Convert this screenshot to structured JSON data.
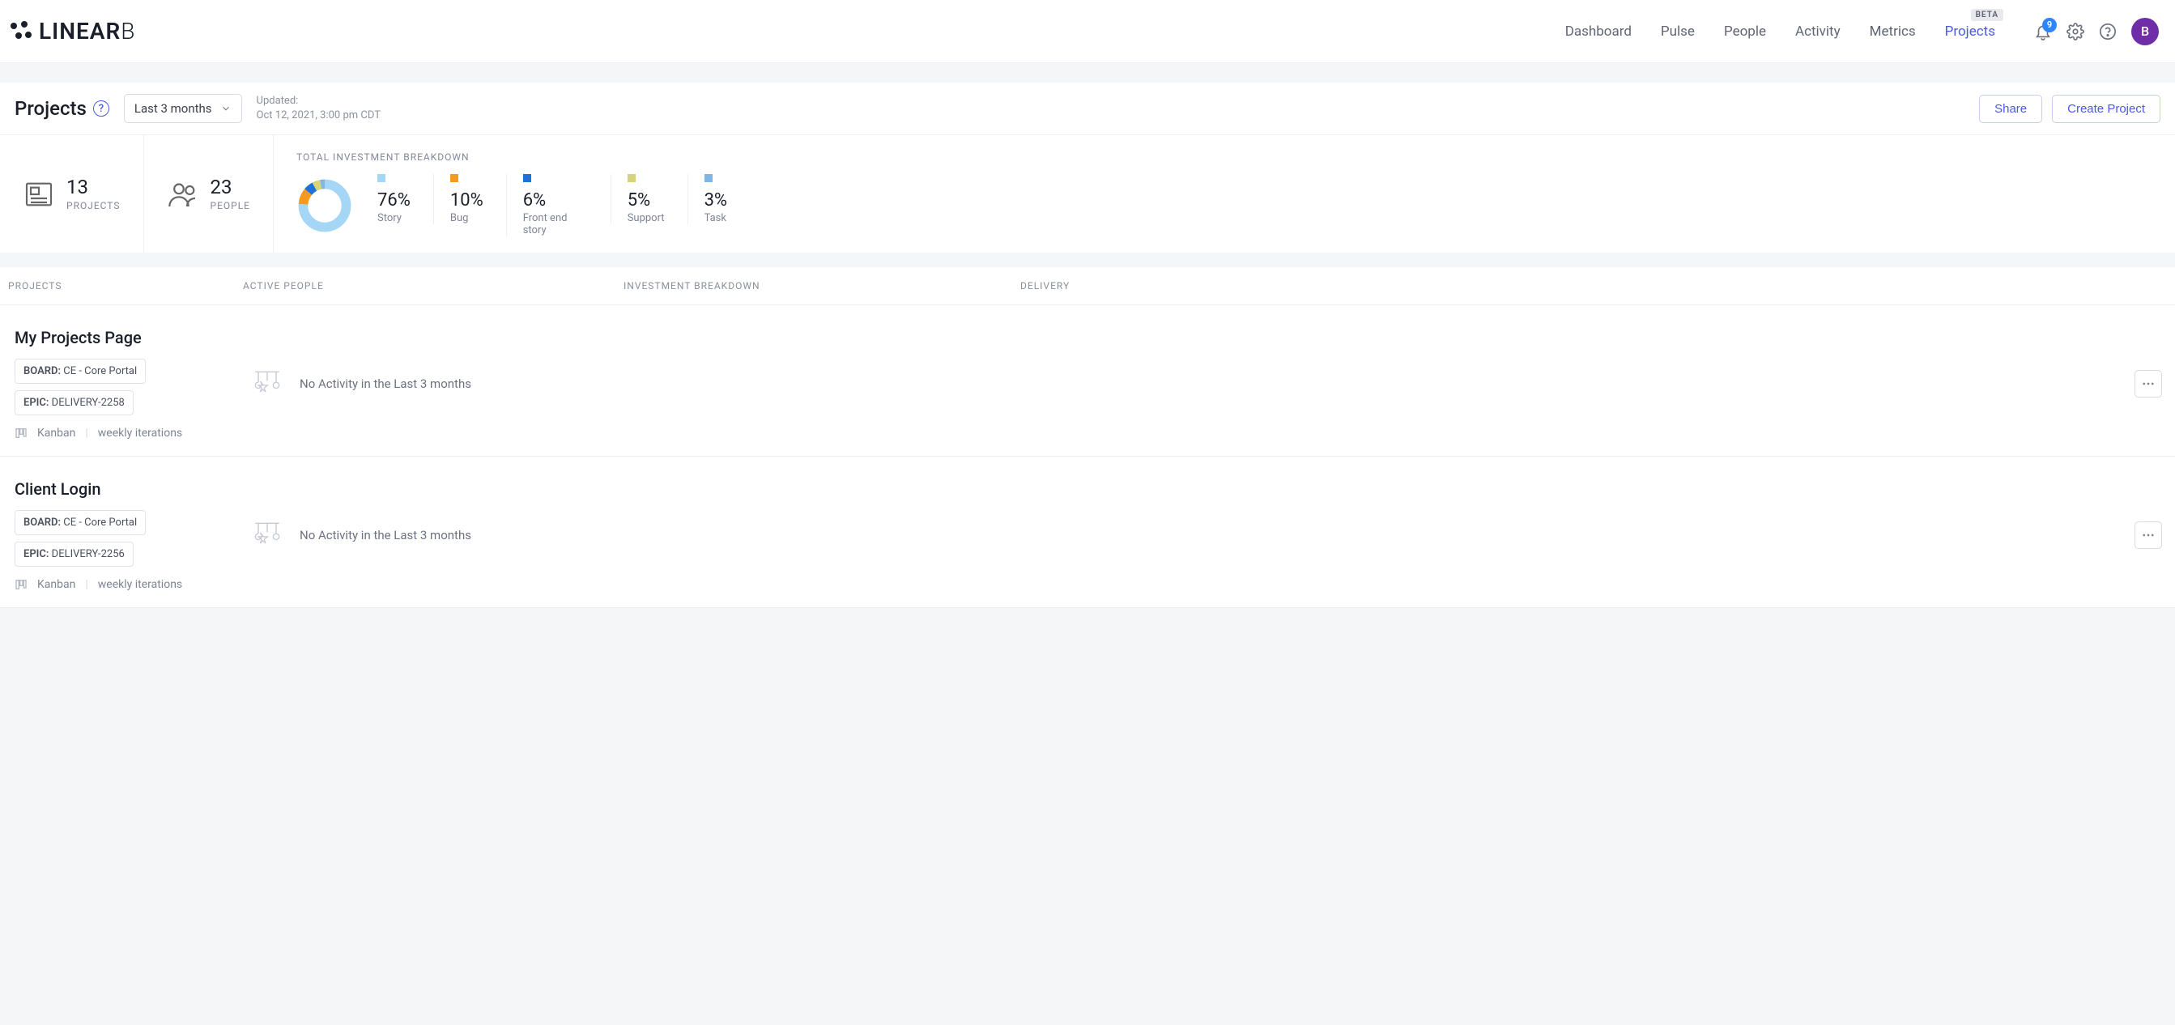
{
  "brand": {
    "name_a": "LINEAR",
    "name_b": "B"
  },
  "nav": {
    "items": [
      {
        "label": "Dashboard",
        "active": false
      },
      {
        "label": "Pulse",
        "active": false
      },
      {
        "label": "People",
        "active": false
      },
      {
        "label": "Activity",
        "active": false
      },
      {
        "label": "Metrics",
        "active": false
      },
      {
        "label": "Projects",
        "active": true,
        "beta": "BETA"
      }
    ],
    "notification_count": "9",
    "avatar_initial": "B"
  },
  "page": {
    "title": "Projects",
    "range_label": "Last 3 months",
    "updated_label": "Updated:",
    "updated_value": "Oct 12, 2021, 3:00 pm CDT",
    "share_label": "Share",
    "create_label": "Create Project"
  },
  "summary": {
    "projects_count": "13",
    "projects_label": "PROJECTS",
    "people_count": "23",
    "people_label": "PEOPLE",
    "investment_title": "TOTAL INVESTMENT BREAKDOWN"
  },
  "chart_data": {
    "type": "pie",
    "title": "Total Investment Breakdown",
    "series": [
      {
        "name": "Story",
        "value": 76,
        "color": "#a6d6f5"
      },
      {
        "name": "Bug",
        "value": 10,
        "color": "#f59a1f"
      },
      {
        "name": "Front end story",
        "value": 6,
        "color": "#1e72d6"
      },
      {
        "name": "Support",
        "value": 5,
        "color": "#d7d37a"
      },
      {
        "name": "Task",
        "value": 3,
        "color": "#7fb6e6"
      }
    ]
  },
  "columns": {
    "projects": "PROJECTS",
    "people": "ACTIVE PEOPLE",
    "investment": "INVESTMENT BREAKDOWN",
    "delivery": "DELIVERY"
  },
  "projects": [
    {
      "name": "My Projects Page",
      "board_key": "BOARD:",
      "board_val": "CE - Core Portal",
      "epic_key": "EPIC:",
      "epic_val": "DELIVERY-2258",
      "method": "Kanban",
      "cadence": "weekly iterations",
      "empty_text": "No Activity in the Last 3 months"
    },
    {
      "name": "Client Login",
      "board_key": "BOARD:",
      "board_val": "CE - Core Portal",
      "epic_key": "EPIC:",
      "epic_val": "DELIVERY-2256",
      "method": "Kanban",
      "cadence": "weekly iterations",
      "empty_text": "No Activity in the Last 3 months"
    }
  ]
}
